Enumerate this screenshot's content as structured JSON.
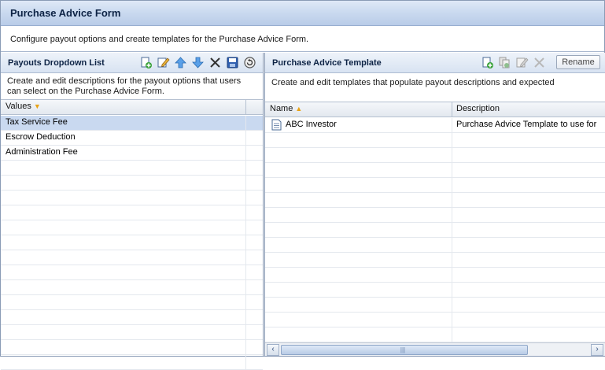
{
  "form": {
    "title": "Purchase Advice Form",
    "description": "Configure payout options and create templates for the Purchase Advice Form."
  },
  "payouts": {
    "title": "Payouts Dropdown List",
    "description_line1": "Create and edit descriptions for the payout options that users",
    "description_line2": "can select on the Purchase Advice Form.",
    "column_header": "Values",
    "column_sort": "descending",
    "items": [
      {
        "label": "Tax Service Fee",
        "selected": true
      },
      {
        "label": "Escrow Deduction",
        "selected": false
      },
      {
        "label": "Administration Fee",
        "selected": false
      }
    ],
    "toolbar": [
      "add-icon",
      "edit-icon",
      "move-up-icon",
      "move-down-icon",
      "delete-icon",
      "save-icon",
      "undo-icon"
    ]
  },
  "template": {
    "title": "Purchase Advice Template",
    "description": "Create and edit templates that populate payout descriptions and expected",
    "columns": {
      "name": "Name",
      "description": "Description"
    },
    "name_sort": "ascending",
    "rows": [
      {
        "name": "ABC Investor",
        "description": "Purchase Advice Template to use for",
        "icon": "document-icon"
      }
    ],
    "toolbar": [
      "add-icon",
      "copy-icon",
      "edit-icon",
      "delete-icon"
    ],
    "rename_label": "Rename"
  },
  "colors": {
    "title_bar": "#c9d9ef",
    "selection": "#c9d9f0",
    "sort_arrow": "#e8a317",
    "border": "#8a9bb5"
  }
}
